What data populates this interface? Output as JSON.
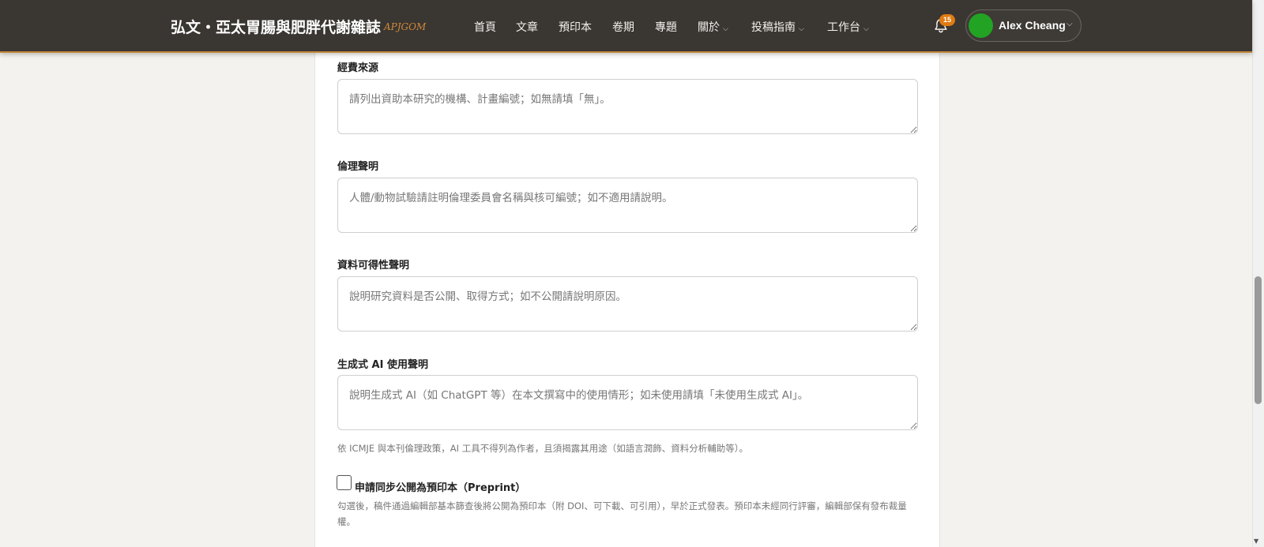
{
  "header": {
    "brand": "弘文・亞太胃腸與肥胖代謝雜誌",
    "brand_abbr": "APJGOM",
    "nav": [
      {
        "label": "首頁",
        "has_menu": false
      },
      {
        "label": "文章",
        "has_menu": false
      },
      {
        "label": "預印本",
        "has_menu": false
      },
      {
        "label": "卷期",
        "has_menu": false
      },
      {
        "label": "專題",
        "has_menu": false
      },
      {
        "label": "關於",
        "has_menu": true
      },
      {
        "label": "投稿指南",
        "has_menu": true
      },
      {
        "label": "工作台",
        "has_menu": true
      }
    ],
    "notification_count": "15",
    "user_name": "Alex Cheang",
    "icons": {
      "bell": "bell-icon",
      "chevron": "chevron-down-icon"
    }
  },
  "form": {
    "funding": {
      "label": "經費來源",
      "placeholder": "請列出資助本研究的機構、計畫編號；如無請填「無」。",
      "value": ""
    },
    "ethics": {
      "label": "倫理聲明",
      "placeholder": "人體/動物試驗請註明倫理委員會名稱與核可編號；如不適用請說明。",
      "value": ""
    },
    "data_availability": {
      "label": "資料可得性聲明",
      "placeholder": "說明研究資料是否公開、取得方式；如不公開請說明原因。",
      "value": ""
    },
    "ai_usage": {
      "label": "生成式 AI 使用聲明",
      "placeholder": "說明生成式 AI（如 ChatGPT 等）在本文撰寫中的使用情形；如未使用請填「未使用生成式 AI」。",
      "value": "",
      "help": "依 ICMJE 與本刊倫理政策，AI 工具不得列為作者，且須揭露其用途（如語言潤飾、資料分析輔助等）。"
    },
    "preprint": {
      "label": "申請同步公開為預印本（Preprint）",
      "checked": false,
      "help": "勾選後，稿件通過編輯部基本篩查後將公開為預印本（附 DOI、可下載、可引用），早於正式發表。預印本未經同行評審，編輯部保有發布裁量權。"
    }
  },
  "colors": {
    "header_bg": "#3a3632",
    "accent": "#c58a3f",
    "badge": "#e07b12",
    "avatar": "#22a323"
  }
}
